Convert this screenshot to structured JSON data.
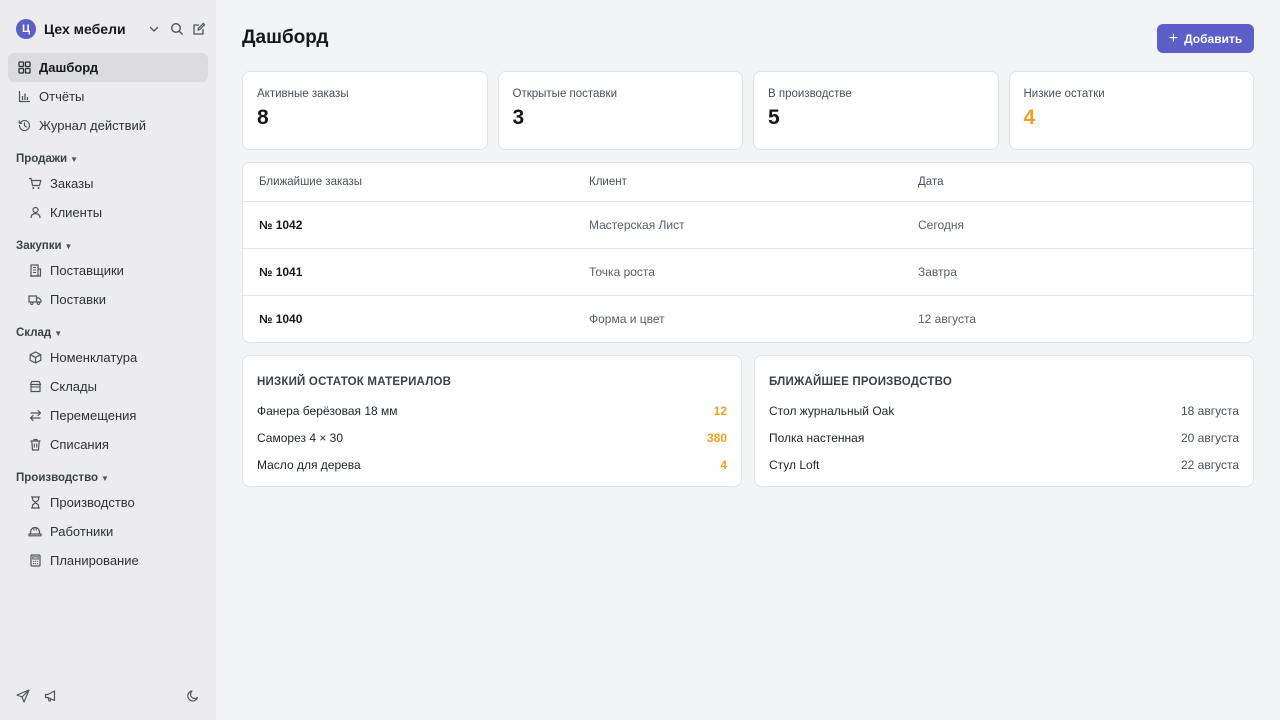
{
  "workspace": {
    "logo_letter": "Ц",
    "name": "Цех мебели"
  },
  "sidebar": {
    "top_items": [
      {
        "label": "Дашборд",
        "icon": "grid-icon",
        "active": true
      },
      {
        "label": "Отчёты",
        "icon": "bar-chart-icon"
      },
      {
        "label": "Журнал действий",
        "icon": "history-icon"
      }
    ],
    "groups": [
      {
        "label": "Продажи",
        "items": [
          {
            "label": "Заказы",
            "icon": "cart-icon"
          },
          {
            "label": "Клиенты",
            "icon": "user-icon"
          }
        ]
      },
      {
        "label": "Закупки",
        "items": [
          {
            "label": "Поставщики",
            "icon": "building-icon"
          },
          {
            "label": "Поставки",
            "icon": "truck-icon"
          }
        ]
      },
      {
        "label": "Склад",
        "items": [
          {
            "label": "Номенклатура",
            "icon": "box-icon"
          },
          {
            "label": "Склады",
            "icon": "store-icon"
          },
          {
            "label": "Перемещения",
            "icon": "swap-icon"
          },
          {
            "label": "Списания",
            "icon": "trash-icon"
          }
        ]
      },
      {
        "label": "Производство",
        "items": [
          {
            "label": "Производство",
            "icon": "hourglass-icon"
          },
          {
            "label": "Работники",
            "icon": "hardhat-icon"
          },
          {
            "label": "Планирование",
            "icon": "calculator-icon"
          }
        ]
      }
    ]
  },
  "header": {
    "title": "Дашборд",
    "add_label": "Добавить"
  },
  "stats": [
    {
      "label": "Активные заказы",
      "value": "8"
    },
    {
      "label": "Открытые поставки",
      "value": "3"
    },
    {
      "label": "В производстве",
      "value": "5"
    },
    {
      "label": "Низкие остатки",
      "value": "4",
      "warn": true
    }
  ],
  "orders": {
    "columns": [
      "Ближайшие заказы",
      "Клиент",
      "Дата"
    ],
    "rows": [
      {
        "number": "№ 1042",
        "client": "Мастерская Лист",
        "date": "Сегодня"
      },
      {
        "number": "№ 1041",
        "client": "Точка роста",
        "date": "Завтра"
      },
      {
        "number": "№ 1040",
        "client": "Форма и цвет",
        "date": "12 августа"
      }
    ]
  },
  "low_stock": {
    "title": "НИЗКИЙ ОСТАТОК МАТЕРИАЛОВ",
    "rows": [
      {
        "name": "Фанера берёзовая 18 мм",
        "value": "12"
      },
      {
        "name": "Саморез 4 × 30",
        "value": "380"
      },
      {
        "name": "Масло для дерева",
        "value": "4"
      }
    ]
  },
  "production": {
    "title": "БЛИЖАЙШЕЕ ПРОИЗВОДСТВО",
    "rows": [
      {
        "name": "Стол журнальный Oak",
        "date": "18 августа"
      },
      {
        "name": "Полка настенная",
        "date": "20 августа"
      },
      {
        "name": "Стул Loft",
        "date": "22 августа"
      }
    ]
  },
  "colors": {
    "accent": "#5b5fc7",
    "warning": "#f0a020"
  }
}
